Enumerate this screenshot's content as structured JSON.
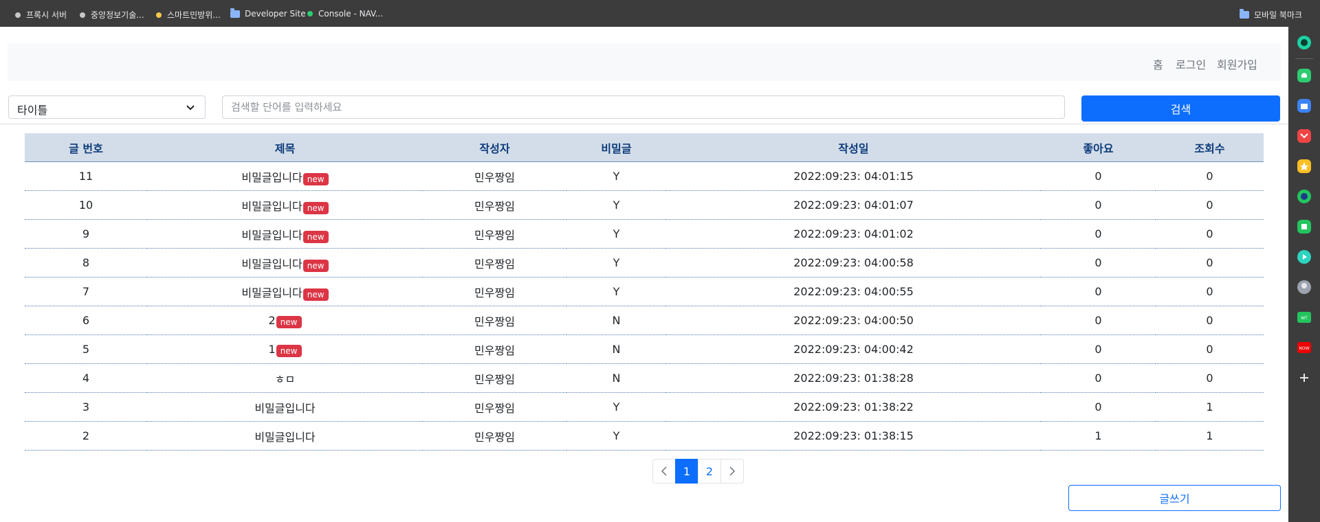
{
  "bookmarks": {
    "items": [
      {
        "label": "프록시 서버",
        "dot_color": "#c8c8c8"
      },
      {
        "label": "중앙정보기술...",
        "dot_color": "#c8c8c8"
      },
      {
        "label": "스마트민방위...",
        "dot_color": "#f2c94c"
      },
      {
        "label": "Developer Site",
        "icon": "folder-icon"
      },
      {
        "label": "Console - NAV...",
        "dot_color": "#2ecc71"
      }
    ],
    "mobile_bookmarks": "모바일 북마크"
  },
  "nav": {
    "home": "홈",
    "login": "로그인",
    "signup": "회원가입"
  },
  "search": {
    "select_value": "타이틀",
    "placeholder": "검색할 단어를 입력하세요",
    "button": "검색"
  },
  "table": {
    "headers": [
      "글 번호",
      "제목",
      "작성자",
      "비밀글",
      "작성일",
      "좋아요",
      "조회수"
    ],
    "new_badge": "new",
    "rows": [
      {
        "no": "11",
        "title": "비밀글입니다",
        "new": true,
        "author": "민우짱임",
        "secret": "Y",
        "date": "2022:09:23: 04:01:15",
        "likes": "0",
        "views": "0"
      },
      {
        "no": "10",
        "title": "비밀글입니다",
        "new": true,
        "author": "민우짱임",
        "secret": "Y",
        "date": "2022:09:23: 04:01:07",
        "likes": "0",
        "views": "0"
      },
      {
        "no": "9",
        "title": "비밀글입니다",
        "new": true,
        "author": "민우짱임",
        "secret": "Y",
        "date": "2022:09:23: 04:01:02",
        "likes": "0",
        "views": "0"
      },
      {
        "no": "8",
        "title": "비밀글입니다",
        "new": true,
        "author": "민우짱임",
        "secret": "Y",
        "date": "2022:09:23: 04:00:58",
        "likes": "0",
        "views": "0"
      },
      {
        "no": "7",
        "title": "비밀글입니다",
        "new": true,
        "author": "민우짱임",
        "secret": "Y",
        "date": "2022:09:23: 04:00:55",
        "likes": "0",
        "views": "0"
      },
      {
        "no": "6",
        "title": "2",
        "new": true,
        "author": "민우짱임",
        "secret": "N",
        "date": "2022:09:23: 04:00:50",
        "likes": "0",
        "views": "0"
      },
      {
        "no": "5",
        "title": "1",
        "new": true,
        "author": "민우짱임",
        "secret": "N",
        "date": "2022:09:23: 04:00:42",
        "likes": "0",
        "views": "0"
      },
      {
        "no": "4",
        "title": "ㅎㅁ",
        "new": false,
        "author": "민우짱임",
        "secret": "N",
        "date": "2022:09:23: 01:38:28",
        "likes": "0",
        "views": "0"
      },
      {
        "no": "3",
        "title": "비밀글입니다",
        "new": false,
        "author": "민우짱임",
        "secret": "Y",
        "date": "2022:09:23: 01:38:22",
        "likes": "0",
        "views": "1"
      },
      {
        "no": "2",
        "title": "비밀글입니다",
        "new": false,
        "author": "민우짱임",
        "secret": "Y",
        "date": "2022:09:23: 01:38:15",
        "likes": "1",
        "views": "1"
      }
    ]
  },
  "pagination": {
    "pages": [
      "1",
      "2"
    ],
    "active": "1"
  },
  "write_button": "글쓰기",
  "sidebar_icons": [
    {
      "name": "circle-icon",
      "color": "#1dd1a1"
    },
    {
      "name": "bell-icon",
      "color": "#2ecc71"
    },
    {
      "name": "briefcase-icon",
      "color": "#3b82f6"
    },
    {
      "name": "pocket-icon",
      "color": "#ef4444"
    },
    {
      "name": "star-icon",
      "color": "#fbbf24"
    },
    {
      "name": "edge-icon",
      "color": "#22c55e"
    },
    {
      "name": "square-icon",
      "color": "#22c55e"
    },
    {
      "name": "play-icon",
      "color": "#2dd4bf"
    },
    {
      "name": "avatar-icon",
      "color": "#9ca3af"
    },
    {
      "name": "webtoon-icon",
      "color": "#22c55e"
    },
    {
      "name": "now-icon",
      "color": "#ef0000"
    },
    {
      "name": "add-icon",
      "color": "#e8eaed"
    }
  ]
}
